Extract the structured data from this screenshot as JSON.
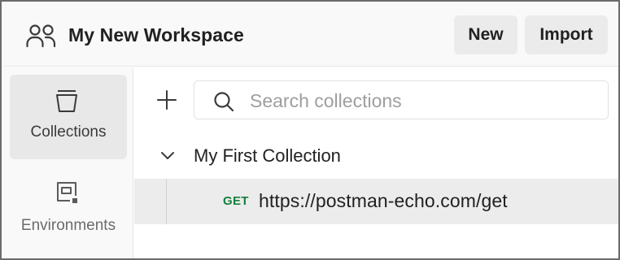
{
  "workspace": {
    "title": "My New Workspace",
    "icon": "team-icon"
  },
  "header": {
    "new_label": "New",
    "import_label": "Import"
  },
  "sidebar": {
    "items": [
      {
        "label": "Collections",
        "icon": "trash-bin-collections-icon",
        "active": true
      },
      {
        "label": "Environments",
        "icon": "environment-icon",
        "active": false
      }
    ]
  },
  "main": {
    "search": {
      "placeholder": "Search collections",
      "value": ""
    },
    "collections": [
      {
        "name": "My First Collection",
        "expanded": true,
        "requests": [
          {
            "method": "GET",
            "url": "https://postman-echo.com/get",
            "selected": true
          }
        ]
      }
    ]
  },
  "colors": {
    "method_get": "#16803c",
    "active_bg": "#e8e8e8",
    "selected_row_bg": "#ececec"
  }
}
